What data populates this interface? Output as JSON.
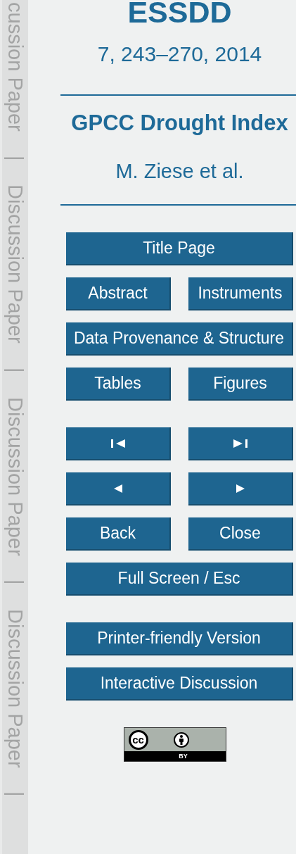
{
  "margin_labels": [
    "cussion Paper",
    "|",
    "Discussion Paper",
    "|",
    "Discussion Paper",
    "|",
    "Discussion Paper",
    "|"
  ],
  "journal": "ESSDD",
  "volume": "7, 243–270, 2014",
  "title": "GPCC Drought Index",
  "authors": "M. Ziese et al.",
  "nav_groups": [
    [
      [
        {
          "kind": "text",
          "label": "Title Page"
        }
      ],
      [
        {
          "kind": "text",
          "label": "Abstract"
        },
        {
          "kind": "text",
          "label": "Instruments"
        }
      ],
      [
        {
          "kind": "text",
          "label": "Data Provenance & Structure"
        }
      ],
      [
        {
          "kind": "text",
          "label": "Tables"
        },
        {
          "kind": "text",
          "label": "Figures"
        }
      ]
    ],
    [
      [
        {
          "kind": "first"
        },
        {
          "kind": "last"
        }
      ],
      [
        {
          "kind": "previous"
        },
        {
          "kind": "next"
        }
      ],
      [
        {
          "kind": "text",
          "label": "Back"
        },
        {
          "kind": "text",
          "label": "Close"
        }
      ],
      [
        {
          "kind": "text",
          "label": "Full Screen / Esc"
        }
      ]
    ],
    [
      [
        {
          "kind": "text",
          "label": "Printer-friendly Version"
        }
      ],
      [
        {
          "kind": "text",
          "label": "Interactive Discussion"
        }
      ]
    ]
  ],
  "license_badge": {
    "mark": "cc",
    "label": "BY"
  }
}
